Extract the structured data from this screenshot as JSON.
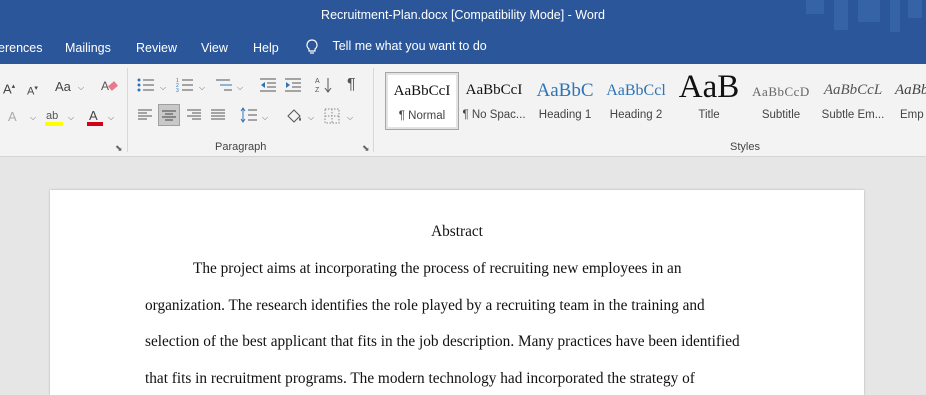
{
  "window": {
    "title": "Recruitment-Plan.docx [Compatibility Mode]  -  Word"
  },
  "menu": {
    "items": [
      "erences",
      "Mailings",
      "Review",
      "View",
      "Help"
    ],
    "tell_me": "Tell me what you want to do"
  },
  "ribbon": {
    "font_group": {
      "grow_font": "A",
      "shrink_font": "A",
      "change_case": "Aa",
      "text_effects": "A",
      "font_color": "A"
    },
    "paragraph_group": {
      "label": "Paragraph",
      "pilcrow": "¶"
    },
    "styles_group": {
      "label": "Styles",
      "items": [
        {
          "sample": "AaBbCcI",
          "label": "¶ Normal",
          "selected": true
        },
        {
          "sample": "AaBbCcI",
          "label": "¶ No Spac..."
        },
        {
          "sample": "AaBbC",
          "label": "Heading 1"
        },
        {
          "sample": "AaBbCcl",
          "label": "Heading 2"
        },
        {
          "sample": "AaB",
          "label": "Title"
        },
        {
          "sample": "AaBbCcD",
          "label": "Subtitle"
        },
        {
          "sample": "AaBbCcL",
          "label": "Subtle Em..."
        },
        {
          "sample": "AaBb",
          "label": "Emp"
        }
      ]
    }
  },
  "document": {
    "heading": "Abstract",
    "lines": [
      "The project aims at incorporating the process of recruiting new employees in an",
      "organization. The research identifies the role played by a recruiting team in the training and",
      "selection of the best applicant that fits in the job description. Many practices have been identified",
      "that fits in recruitment programs. The modern technology had incorporated the strategy of"
    ]
  },
  "colors": {
    "word_blue": "#2b579a",
    "font_color_red": "#d0021b",
    "highlight_yellow": "#ffff00",
    "heading1_blue": "#2e74b5"
  }
}
